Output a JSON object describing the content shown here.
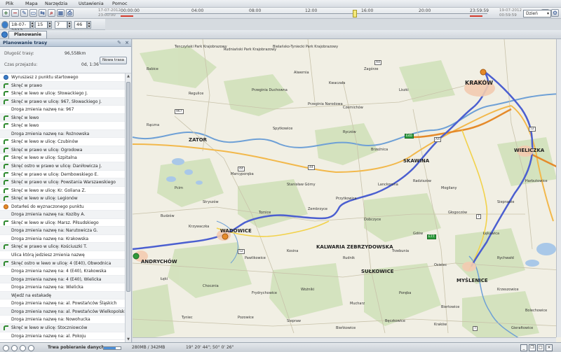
{
  "menu": {
    "items": [
      "Plik",
      "Mapa",
      "Narzędzia",
      "Ustawienia",
      "Pomoc"
    ]
  },
  "toolbar": {
    "icons": [
      "add-icon",
      "remove-icon",
      "edit-icon",
      "open-icon",
      "export-icon",
      "search-icon",
      "grid-icon",
      "print-icon"
    ]
  },
  "timeline": {
    "left_date_top": "17-07-2012",
    "left_time_bottom": "23:00:00",
    "right_date_top": "19-07-2012",
    "right_time_bottom": "00:59:59",
    "tick_labels": [
      "00:00:00",
      "04:00",
      "08:00",
      "12:00",
      "16:00",
      "20:00",
      "23:59:59"
    ],
    "zoom_value": "Dzień"
  },
  "datepicker": {
    "date": "18-07-2012",
    "hour": "15",
    "minute": "7",
    "second": "46"
  },
  "tabs": {
    "route_planning": "Planowanie trasy"
  },
  "panel": {
    "title": "Planowanie trasy",
    "distance_label": "Długość trasy:",
    "distance_value": "96,558km",
    "time_label": "Czas przejazdu:",
    "time_value": "0d, 1:36",
    "new_route_button": "Nowa trasa",
    "directions": [
      {
        "icon": "start",
        "text": "Wyruszasz z punktu startowego"
      },
      {
        "icon": "turn",
        "text": "Skręć w prawo"
      },
      {
        "icon": "turn",
        "text": "Skręć w lewo w ulicę: Słowackiego J."
      },
      {
        "icon": "turn",
        "text": "Skręć w prawo w ulicę: 967, Słowackiego J."
      },
      {
        "icon": "none",
        "text": "Droga zmienia nazwę na: 967"
      },
      {
        "icon": "turn",
        "text": "Skręć w lewo"
      },
      {
        "icon": "turn",
        "text": "Skręć w lewo"
      },
      {
        "icon": "none",
        "text": "Droga zmienia nazwę na: Rożnowska"
      },
      {
        "icon": "turn",
        "text": "Skręć w lewo w ulicę: Czubinów"
      },
      {
        "icon": "turn",
        "text": "Skręć w prawo w ulicę: Ogrodowa"
      },
      {
        "icon": "turn",
        "text": "Skręć w lewo w ulicę: Szpitalna"
      },
      {
        "icon": "turn",
        "text": "Skręć ostro w prawo w ulicę: Daniłowicza J."
      },
      {
        "icon": "turn",
        "text": "Skręć w prawo w ulicę: Dembowskiego E."
      },
      {
        "icon": "turn",
        "text": "Skręć w prawo w ulicę: Powstania Warszawskiego"
      },
      {
        "icon": "turn",
        "text": "Skręć w lewo w ulicę: Kr. Goliana Z."
      },
      {
        "icon": "turn",
        "text": "Skręć w lewo w ulicę: Legionów"
      },
      {
        "icon": "end",
        "text": "Dotarłeś do wyznaczonego punktu"
      },
      {
        "icon": "none",
        "text": "Droga zmienia nazwę na: Koziby A."
      },
      {
        "icon": "turn",
        "text": "Skręć w lewo w ulicę: Marsz. Piłsudskiego"
      },
      {
        "icon": "none",
        "text": "Droga zmienia nazwę na: Narutowicza G."
      },
      {
        "icon": "none",
        "text": "Droga zmienia nazwę na: Krakowska"
      },
      {
        "icon": "turn",
        "text": "Skręć w prawo w ulicę: Kościuszki T."
      },
      {
        "icon": "none",
        "text": "Ulica którą jedziesz zmienia nazwę"
      },
      {
        "icon": "turn",
        "text": "Skręć ostro w lewo w ulicę: 4 (E40), Obwodnica"
      },
      {
        "icon": "none",
        "text": "Droga zmienia nazwę na: 4 (E40), Krakowska"
      },
      {
        "icon": "none",
        "text": "Droga zmienia nazwę na: 4 (E40), Wielicka"
      },
      {
        "icon": "none",
        "text": "Droga zmienia nazwę na: Wielicka"
      },
      {
        "icon": "none",
        "text": "Wjedź na estakadę"
      },
      {
        "icon": "none",
        "text": "Droga zmienia nazwę na: al. Powstańców Śląskich"
      },
      {
        "icon": "none",
        "text": "Droga zmienia nazwę na: al. Powstańców Wielkopolskich"
      },
      {
        "icon": "none",
        "text": "Droga zmienia nazwę na: Nowohucka"
      },
      {
        "icon": "turn",
        "text": "Skręć w lewo w ulicę: Stoczniowców"
      },
      {
        "icon": "none",
        "text": "Droga zmienia nazwę na: al. Pokoju"
      }
    ]
  },
  "map": {
    "cities": [
      "KRAKÓW",
      "WIELICZKA",
      "ZATOR",
      "SKAWINA",
      "WADOWICE",
      "KALWARIA ZEBRZYDOWSKA",
      "SUŁKOWICE",
      "MYŚLENICE",
      "ANDRYCHÓW"
    ],
    "towns": [
      "Tenczyński Park Krajobrazowy",
      "Rudniański Park Krajobrazowy",
      "Bielańsko-Tyniecki Park Krajobrazowy",
      "Babice",
      "Alwernia",
      "Kwaczała",
      "Zagórze",
      "Regulice",
      "Przeginia Duchowna",
      "Przeginia Narodowa",
      "Czernichów",
      "Liszki",
      "Rączna",
      "Spytkowice",
      "Ryczów",
      "Brzeźnica",
      "Marcyporęba",
      "Stanisław Górny",
      "Przytkowice",
      "Lanckorona",
      "Radziszów",
      "Mogilany",
      "Głogoczów",
      "Sieprawie",
      "Pcim",
      "Stryszów",
      "Tomice",
      "Zembrzyce",
      "Dobczyce",
      "Gdów",
      "Łękawica",
      "Harbutowice",
      "Budzów",
      "Krzywaczka",
      "Pawlikowice",
      "Kosina",
      "Rudnik",
      "Trzebunia",
      "Osielec",
      "Rychwałd",
      "Łęki",
      "Chocznia",
      "Frydrychowice",
      "Wożniki",
      "Mucharz",
      "Poręba",
      "Biertowice",
      "Krzeszowice",
      "Bolechowice",
      "Tyniec",
      "Pozowice",
      "Siepraw",
      "Bieńkowice",
      "Bęczkowice",
      "Kraków",
      "Gierałtowice"
    ],
    "road_badges": [
      "44",
      "A4",
      "44",
      "E40",
      "E77",
      "52",
      "7",
      "A4",
      "52",
      "7",
      "967"
    ]
  },
  "statusbar": {
    "loading_text": "Trwa pobieranie danych",
    "memory_text": "280MB / 342MB",
    "coords_text": "19° 20' 44\"; 50° 0' 26\""
  }
}
